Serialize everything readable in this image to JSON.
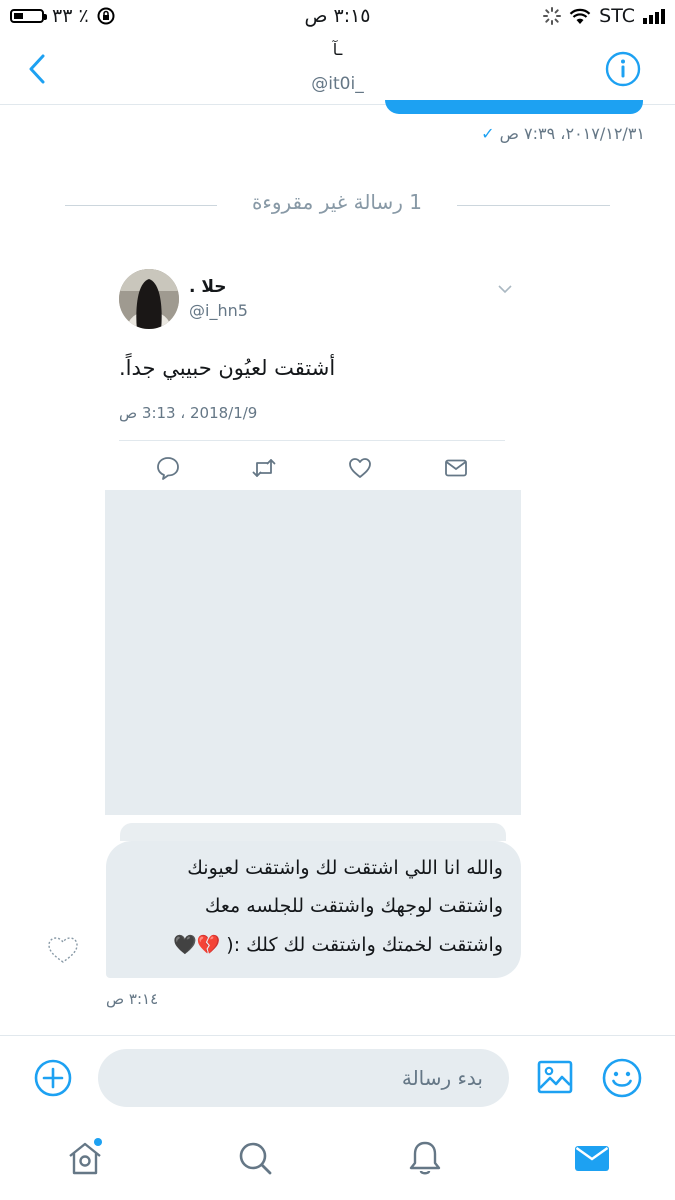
{
  "status_bar": {
    "carrier": "STC",
    "time": "٣:١٥ ص",
    "battery": "٪ ٣٣",
    "battery_level": 0.33
  },
  "header": {
    "name": "ـآ",
    "handle": "@it0i_"
  },
  "thread": {
    "sent_meta": "٢٠١٧/١٢/٣١، ٧:٣٩ ص",
    "unread_divider": "1 رسالة غير مقروءة",
    "tweet": {
      "author_name": "حلا .",
      "author_handle": "@i_hn5",
      "text": "أشتقت لعيُون حبيبي جداً.",
      "timestamp": "2018/1/9 ، 3:13 ص"
    },
    "message": {
      "lines": [
        "والله انا اللي اشتقت لك واشتقت لعيونك",
        "واشتقت لوجهك واشتقت للجلسه معك",
        "واشتقت لخمتك واشتقت لك كلك :( 💔🖤"
      ],
      "time": "٣:١٤ ص"
    }
  },
  "composer": {
    "placeholder": "بدء رسالة"
  },
  "colors": {
    "accent": "#1da1f2",
    "bubble": "#e6ecf0",
    "muted": "#657786"
  }
}
